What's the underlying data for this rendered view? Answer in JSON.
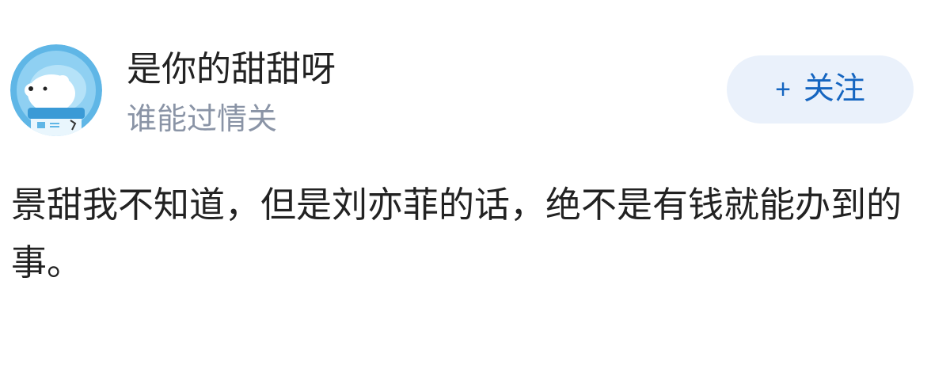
{
  "author": {
    "name": "是你的甜甜呀",
    "bio": "谁能过情关",
    "avatar_icon": "polar-bear-astronaut-icon"
  },
  "follow": {
    "plus": "+",
    "label": "关注"
  },
  "post": {
    "text": "景甜我不知道，但是刘亦菲的话，绝不是有钱就能办到的事。"
  },
  "colors": {
    "username": "#222222",
    "bio": "#8a94a6",
    "follow_bg": "#eaf1fb",
    "follow_text": "#1565c0",
    "avatar_bg": "#5fb6e6"
  }
}
